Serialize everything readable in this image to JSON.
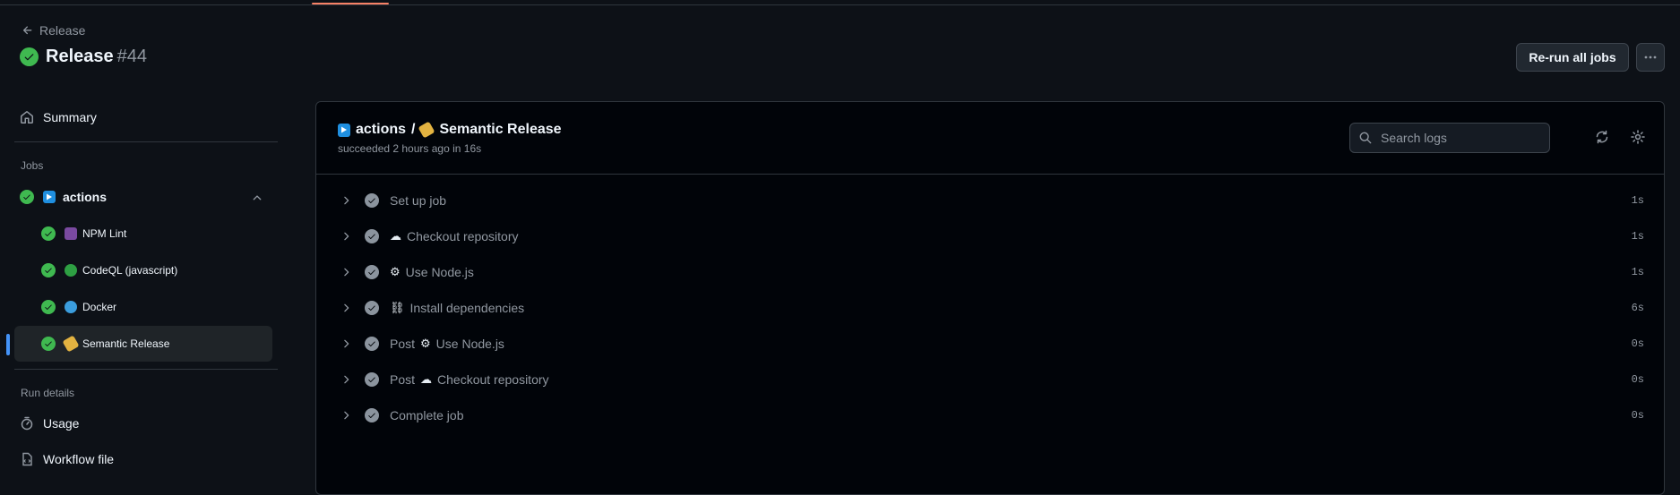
{
  "header": {
    "back_label": "Release",
    "title": "Release",
    "run_number": "#44",
    "rerun_label": "Re-run all jobs"
  },
  "sidebar": {
    "summary_label": "Summary",
    "jobs_heading": "Jobs",
    "group_label": "actions",
    "jobs": [
      {
        "label": "NPM Lint",
        "icon": "lint-emoji-icon"
      },
      {
        "label": "CodeQL (javascript)",
        "icon": "bug-emoji-icon"
      },
      {
        "label": "Docker",
        "icon": "whale-emoji-icon"
      },
      {
        "label": "Semantic Release",
        "icon": "label-emoji-icon",
        "active": true
      }
    ],
    "run_details_heading": "Run details",
    "usage_label": "Usage",
    "workflow_file_label": "Workflow file"
  },
  "job": {
    "group": "actions",
    "separator": "/",
    "name": "Semantic Release",
    "status_text": "succeeded 2 hours ago in 16s",
    "search_placeholder": "Search logs"
  },
  "steps": [
    {
      "prefix": "",
      "emoji": "",
      "name": "Set up job",
      "duration": "1s"
    },
    {
      "prefix": "",
      "emoji": "☁",
      "name": "Checkout repository",
      "duration": "1s"
    },
    {
      "prefix": "",
      "emoji": "⚙",
      "name": "Use Node.js",
      "duration": "1s"
    },
    {
      "prefix": "",
      "emoji": "⛓",
      "name": "Install dependencies",
      "duration": "6s"
    },
    {
      "prefix": "Post",
      "emoji": "⚙",
      "name": "Use Node.js",
      "duration": "0s"
    },
    {
      "prefix": "Post",
      "emoji": "☁",
      "name": "Checkout repository",
      "duration": "0s"
    },
    {
      "prefix": "",
      "emoji": "",
      "name": "Complete job",
      "duration": "0s"
    }
  ],
  "colors": {
    "background": "#0d1117",
    "success": "#3fb950",
    "accent": "#4493f8",
    "tab_underline": "#f78166"
  }
}
